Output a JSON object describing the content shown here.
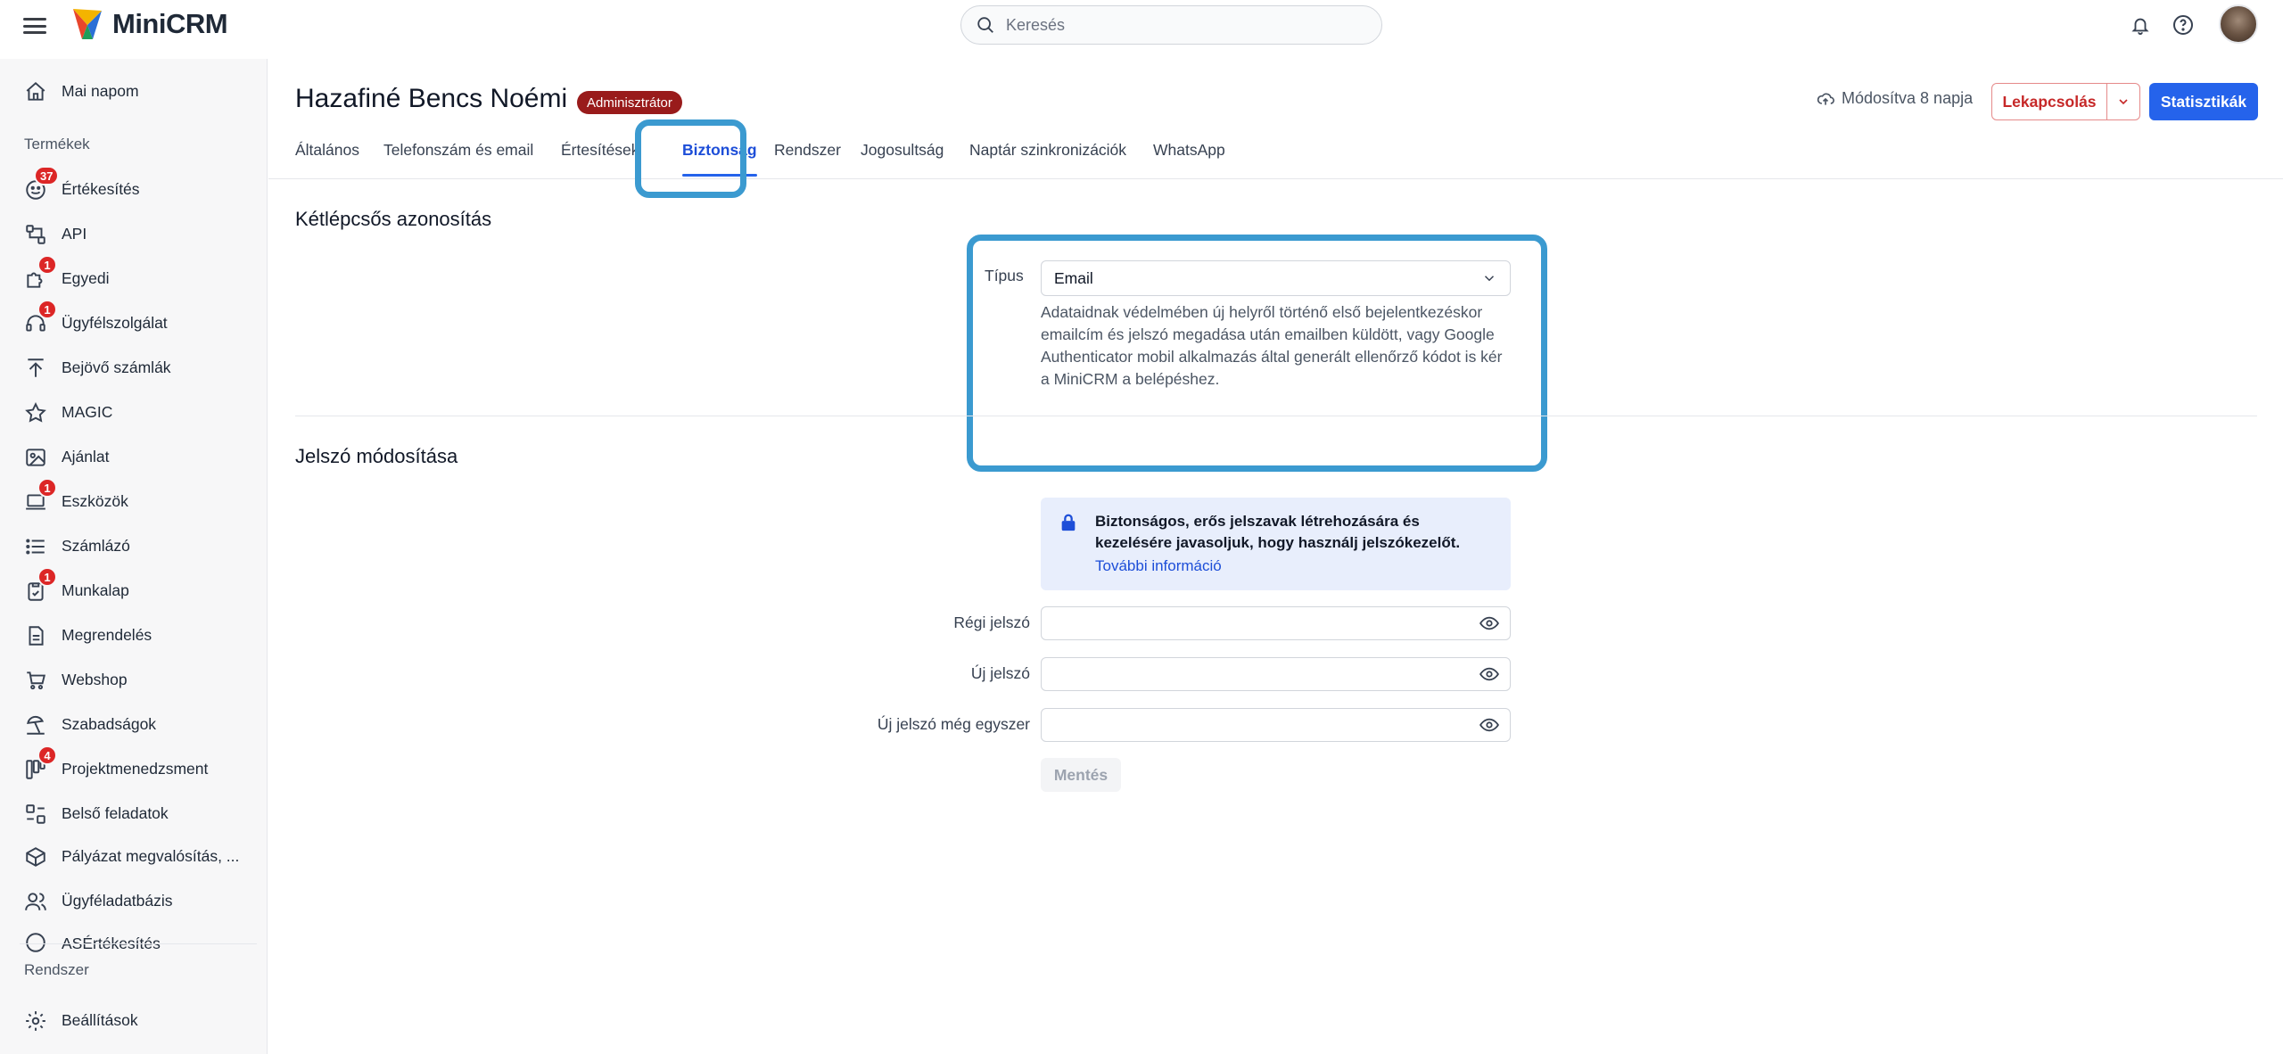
{
  "header": {
    "logo_text": "MiniCRM",
    "search_placeholder": "Keresés"
  },
  "sidebar": {
    "top_item": "Mai napom",
    "section_products": "Termékek",
    "items": [
      {
        "label": "Értékesítés",
        "icon": "sales-icon",
        "badge": "37"
      },
      {
        "label": "API",
        "icon": "api-icon",
        "badge": ""
      },
      {
        "label": "Egyedi",
        "icon": "puzzle-icon",
        "badge": "1"
      },
      {
        "label": "Ügyfélszolgálat",
        "icon": "headset-icon",
        "badge": "1"
      },
      {
        "label": "Bejövő számlák",
        "icon": "upload-arrow-icon",
        "badge": ""
      },
      {
        "label": "MAGIC",
        "icon": "star-icon",
        "badge": ""
      },
      {
        "label": "Ajánlat",
        "icon": "image-icon",
        "badge": ""
      },
      {
        "label": "Eszközök",
        "icon": "laptop-icon",
        "badge": "1"
      },
      {
        "label": "Számlázó",
        "icon": "list-icon",
        "badge": ""
      },
      {
        "label": "Munkalap",
        "icon": "clipboard-icon",
        "badge": "1"
      },
      {
        "label": "Megrendelés",
        "icon": "document-icon",
        "badge": ""
      },
      {
        "label": "Webshop",
        "icon": "cart-icon",
        "badge": ""
      },
      {
        "label": "Szabadságok",
        "icon": "beach-icon",
        "badge": ""
      },
      {
        "label": "Projektmenedzsment",
        "icon": "kanban-icon",
        "badge": "4"
      },
      {
        "label": "Belső feladatok",
        "icon": "tasks-icon",
        "badge": ""
      },
      {
        "label": "Pályázat megvalósítás, ...",
        "icon": "box-icon",
        "badge": ""
      },
      {
        "label": "Ügyféladatbázis",
        "icon": "users-icon",
        "badge": ""
      },
      {
        "label": "ASÉrtékesítés",
        "icon": "sales-icon",
        "badge": ""
      }
    ],
    "section_system": "Rendszer",
    "settings": "Beállítások"
  },
  "user": {
    "name": "Hazafiné Bencs Noémi",
    "role": "Adminisztrátor",
    "modified": "Módosítva 8 napja",
    "unlink_label": "Lekapcsolás",
    "stats_label": "Statisztikák"
  },
  "tabs": [
    "Általános",
    "Telefonszám és email",
    "Értesítések",
    "Biztonság",
    "Rendszer",
    "Jogosultság",
    "Naptár szinkronizációk",
    "WhatsApp"
  ],
  "two_factor": {
    "title": "Kétlépcsős azonosítás",
    "type_label": "Típus",
    "type_value": "Email",
    "help": "Adataidnak védelmében új helyről történő első bejelentkezéskor emailcím és jelszó megadása után emailben küldött, vagy Google Authenticator mobil alkalmazás által generált ellenőrző kódot is kér a MiniCRM a belépéshez."
  },
  "password": {
    "title": "Jelszó módosítása",
    "info": "Biztonságos, erős jelszavak létrehozására és kezelésére javasoljuk, hogy használj jelszókezelőt.",
    "info_link": "További információ",
    "old_label": "Régi jelszó",
    "new_label": "Új jelszó",
    "repeat_label": "Új jelszó még egyszer",
    "save_label": "Mentés"
  },
  "colors": {
    "accent": "#2563eb",
    "highlight": "#3b9ad0",
    "badge": "#dc2626",
    "role_badge": "#991b1b"
  }
}
